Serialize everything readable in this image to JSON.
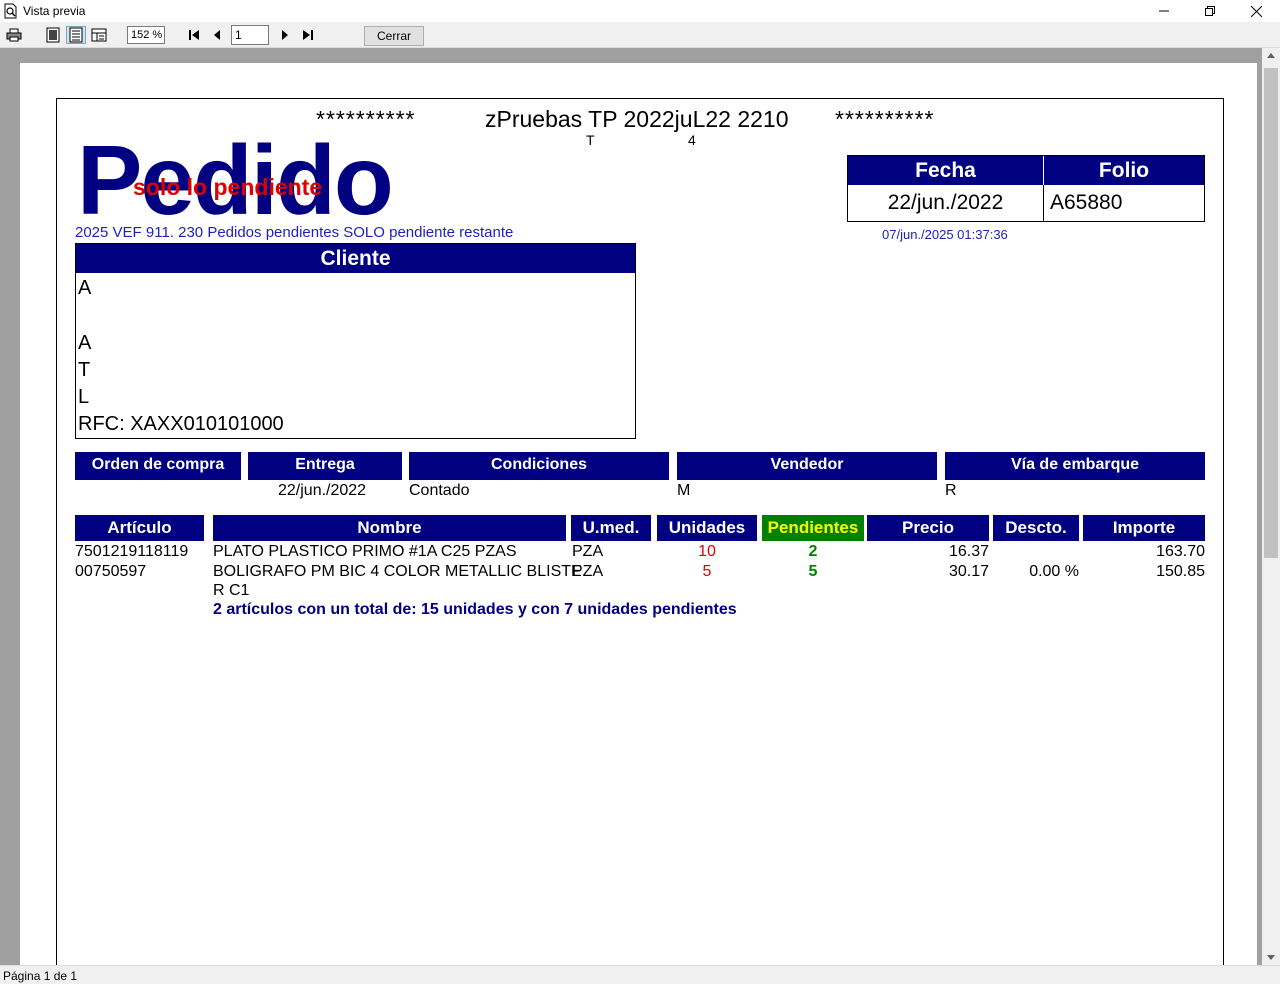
{
  "window": {
    "title": "Vista previa"
  },
  "toolbar": {
    "zoom": "152 %",
    "page_number": "1",
    "close_label": "Cerrar"
  },
  "status": {
    "page_info": "Página 1 de 1"
  },
  "report": {
    "stars_left": "**********",
    "stars_right": "**********",
    "company": "zPruebas TP 2022juL22 2210",
    "glyph_t": "T",
    "glyph_4": "4",
    "title": "Pedido",
    "subtitle": "solo lo pendiente",
    "report_line": "2025 VEF 911. 230 Pedidos pendientes SOLO pendiente restante",
    "fecha_label": "Fecha",
    "folio_label": "Folio",
    "fecha_value": "22/jun./2022",
    "folio_value": "A65880",
    "timestamp": "07/jun./2025 01:37:36",
    "cliente_label": "Cliente",
    "cliente_lines": [
      "A",
      "A",
      "T",
      "L",
      "RFC: XAXX010101000"
    ],
    "info_headers": [
      "Orden de compra",
      "Entrega",
      "Condiciones",
      "Vendedor",
      "Vía de embarque"
    ],
    "info_values": [
      "",
      "22/jun./2022",
      "Contado",
      "M",
      "R"
    ],
    "columns": [
      "Artículo",
      "Nombre",
      "U.med.",
      "Unidades",
      "Pendientes",
      "Precio",
      "Descto.",
      "Importe"
    ],
    "rows": [
      {
        "articulo": "7501219118119",
        "nombre": "PLATO PLASTICO PRIMO #1A C25 PZAS",
        "umed": "PZA",
        "unidades": "10",
        "pendientes": "2",
        "precio": "16.37",
        "descto": "",
        "importe": "163.70"
      },
      {
        "articulo": "00750597",
        "nombre": "BOLIGRAFO PM BIC 4 COLOR METALLIC BLISTE",
        "nombre2": "R C1",
        "umed": "PZA",
        "unidades": "5",
        "pendientes": "5",
        "precio": "30.17",
        "descto": "0.00 %",
        "importe": "150.85"
      }
    ],
    "total_line": "2 artículos con un total de: 15 unidades y con 7 unidades pendientes"
  },
  "colors": {
    "navy": "#000080",
    "green": "#008000",
    "red": "#e00000",
    "yellow": "#ffff00"
  }
}
